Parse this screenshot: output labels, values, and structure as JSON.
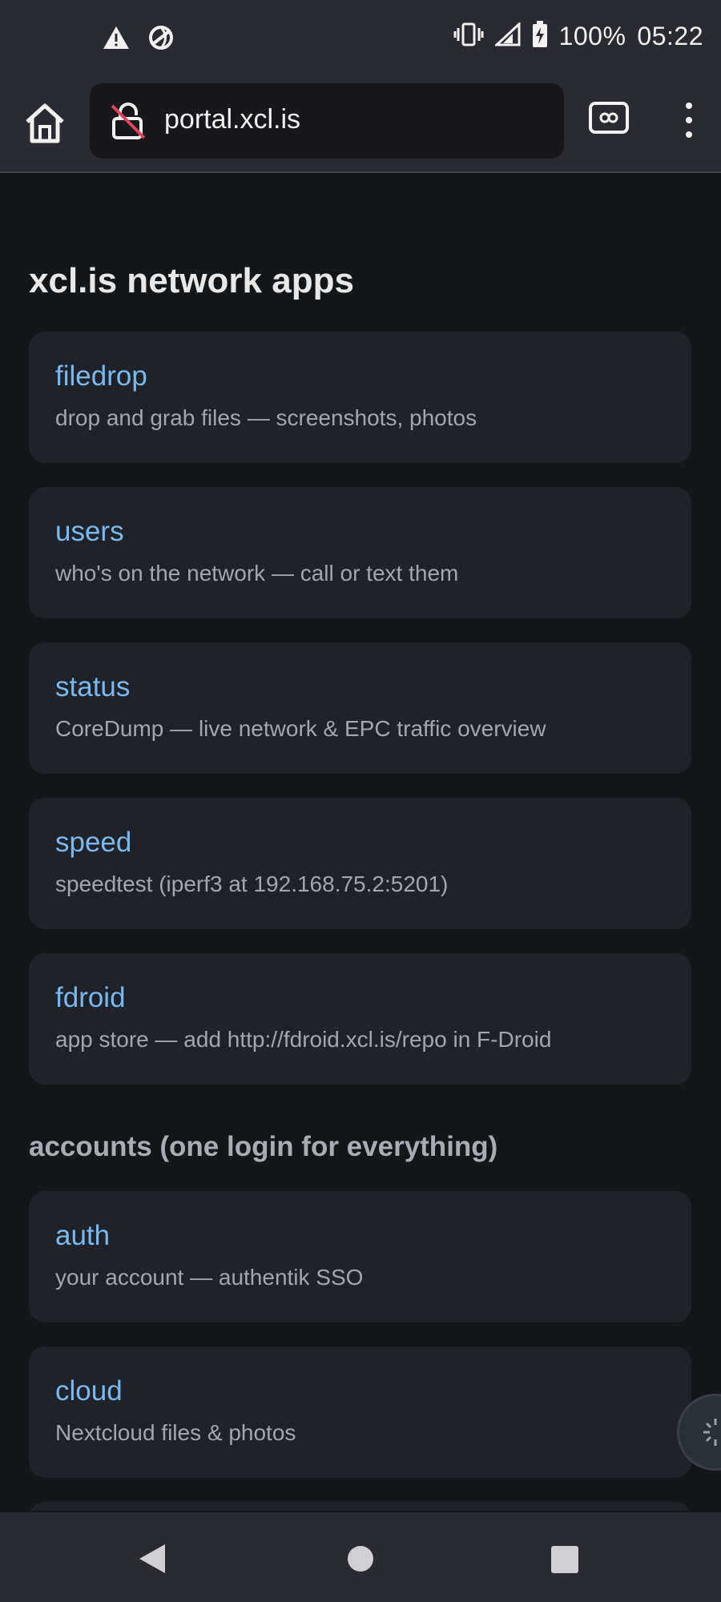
{
  "status_bar": {
    "battery": "100%",
    "time": "05:22",
    "icons": [
      "warning-icon",
      "sync-icon",
      "vibrate-icon",
      "signal-icon",
      "battery-charging-icon"
    ]
  },
  "browser": {
    "url": "portal.xcl.is",
    "icons": [
      "home-icon",
      "not-secure-lock-icon",
      "tabs-icon",
      "more-vert-icon"
    ]
  },
  "page": {
    "title": "xcl.is network apps",
    "apps": [
      {
        "name": "filedrop",
        "desc": "drop and grab files — screenshots, photos"
      },
      {
        "name": "users",
        "desc": "who's on the network — call or text them"
      },
      {
        "name": "status",
        "desc": "CoreDump — live network & EPC traffic overview"
      },
      {
        "name": "speed",
        "desc": "speedtest (iperf3 at 192.168.75.2:5201)"
      },
      {
        "name": "fdroid",
        "desc": "app store — add http://fdroid.xcl.is/repo in F-Droid"
      }
    ],
    "accounts_title": "accounts (one login for everything)",
    "accounts": [
      {
        "name": "auth",
        "desc": "your account — authentik SSO"
      },
      {
        "name": "cloud",
        "desc": "Nextcloud files & photos"
      }
    ]
  },
  "colors": {
    "link": "#7ab8ee",
    "card": "#1f2329",
    "background": "#141719",
    "chrome": "#2a2a33"
  }
}
